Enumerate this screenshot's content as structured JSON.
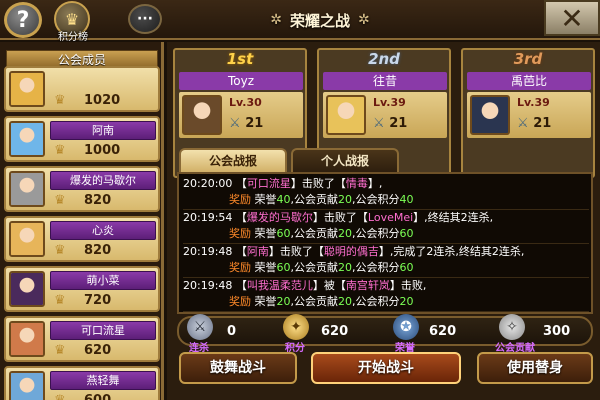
{
  "top_bar": {
    "help_glyph": "?",
    "rank_label": "积分榜",
    "chat_glyph": "···",
    "title": "荣耀之战",
    "close_glyph": "✕"
  },
  "members": {
    "header": "公会成员",
    "list": [
      {
        "name": "",
        "score": "1020",
        "avatar_color": "#e6b347"
      },
      {
        "name": "阿南",
        "score": "1000",
        "avatar_color": "#6fb6e9"
      },
      {
        "name": "爆发的马歇尔",
        "score": "820",
        "avatar_color": "#9a9a9a"
      },
      {
        "name": "心炎",
        "score": "820",
        "avatar_color": "#e7b55a"
      },
      {
        "name": "萌小菜",
        "score": "720",
        "avatar_color": "#4a2a5c"
      },
      {
        "name": "可口流星",
        "score": "620",
        "avatar_color": "#d07a4a"
      },
      {
        "name": "燕轻舞",
        "score": "600",
        "avatar_color": "#6fa8d8"
      }
    ]
  },
  "podium": [
    {
      "rank": "1st",
      "name": "Toyz",
      "level": "Lv.30",
      "wins": "21",
      "avatar_color": "#6a4a2a"
    },
    {
      "rank": "2nd",
      "name": "往昔",
      "level": "Lv.39",
      "wins": "21",
      "avatar_color": "#e8c25a"
    },
    {
      "rank": "3rd",
      "name": "禹芭比",
      "level": "Lv.39",
      "wins": "21",
      "avatar_color": "#2a3550"
    }
  ],
  "tabs": {
    "guild": "公会战报",
    "personal": "个人战报"
  },
  "log": [
    {
      "line1": [
        {
          "t": "20:20:00 【",
          "c": "w"
        },
        {
          "t": "可口流星",
          "c": "h"
        },
        {
          "t": "】击败了【",
          "c": "w"
        },
        {
          "t": "情毒",
          "c": "h"
        },
        {
          "t": "】,",
          "c": "w"
        }
      ],
      "line2": [
        {
          "t": "奖励 ",
          "c": "r"
        },
        {
          "t": "荣誉",
          "c": "w"
        },
        {
          "t": "40",
          "c": "n"
        },
        {
          "t": ",公会贡献",
          "c": "w"
        },
        {
          "t": "20",
          "c": "n"
        },
        {
          "t": ",公会积分",
          "c": "w"
        },
        {
          "t": "40",
          "c": "n"
        }
      ]
    },
    {
      "line1": [
        {
          "t": "20:19:54 【",
          "c": "w"
        },
        {
          "t": "爆发的马歇尔",
          "c": "h"
        },
        {
          "t": "】击败了【",
          "c": "w"
        },
        {
          "t": "LoveMei",
          "c": "h"
        },
        {
          "t": "】,终结其2连杀,",
          "c": "w"
        }
      ],
      "line2": [
        {
          "t": "奖励 ",
          "c": "r"
        },
        {
          "t": "荣誉",
          "c": "w"
        },
        {
          "t": "60",
          "c": "n"
        },
        {
          "t": ",公会贡献",
          "c": "w"
        },
        {
          "t": "20",
          "c": "n"
        },
        {
          "t": ",公会积分",
          "c": "w"
        },
        {
          "t": "60",
          "c": "n"
        }
      ]
    },
    {
      "line1": [
        {
          "t": "20:19:48 【",
          "c": "w"
        },
        {
          "t": "阿南",
          "c": "h"
        },
        {
          "t": "】击败了【",
          "c": "w"
        },
        {
          "t": "聪明的偶吉",
          "c": "h"
        },
        {
          "t": "】,完成了2连杀,终结其2连杀,",
          "c": "w"
        }
      ],
      "line2": [
        {
          "t": "奖励 ",
          "c": "r"
        },
        {
          "t": "荣誉",
          "c": "w"
        },
        {
          "t": "60",
          "c": "n"
        },
        {
          "t": ",公会贡献",
          "c": "w"
        },
        {
          "t": "20",
          "c": "n"
        },
        {
          "t": ",公会积分",
          "c": "w"
        },
        {
          "t": "60",
          "c": "n"
        }
      ]
    },
    {
      "line1": [
        {
          "t": "20:19:48 【",
          "c": "w"
        },
        {
          "t": "叫我温柔范儿",
          "c": "h"
        },
        {
          "t": "】被【",
          "c": "w"
        },
        {
          "t": "南宫轩岚",
          "c": "h"
        },
        {
          "t": "】击败,",
          "c": "w"
        }
      ],
      "line2": [
        {
          "t": "奖励 ",
          "c": "r"
        },
        {
          "t": "荣誉",
          "c": "w"
        },
        {
          "t": "20",
          "c": "n"
        },
        {
          "t": ",公会贡献",
          "c": "w"
        },
        {
          "t": "20",
          "c": "n"
        },
        {
          "t": ",公会积分",
          "c": "w"
        },
        {
          "t": "20",
          "c": "n"
        }
      ]
    }
  ],
  "stats": {
    "streak": {
      "label": "连杀",
      "value": "0"
    },
    "points": {
      "label": "积分",
      "value": "620"
    },
    "honor": {
      "label": "荣誉",
      "value": "620"
    },
    "contribution": {
      "label": "公会贡献",
      "value": "300"
    }
  },
  "buttons": {
    "encourage": "鼓舞战斗",
    "start": "开始战斗",
    "substitute": "使用替身"
  }
}
